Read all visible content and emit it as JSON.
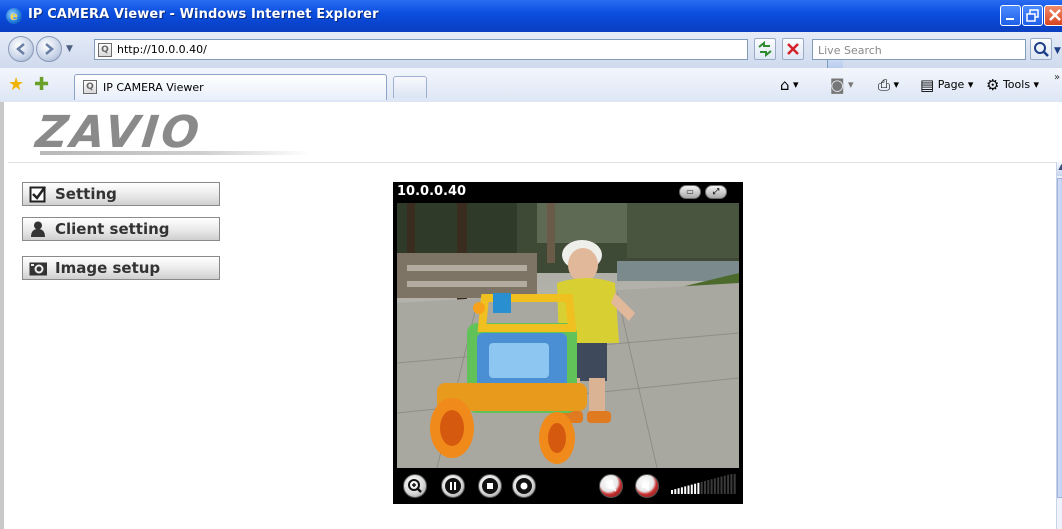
{
  "window": {
    "title": "IP CAMERA Viewer - Windows Internet Explorer",
    "controls": {
      "minimize": "_",
      "maximize": "□",
      "close": "X"
    }
  },
  "addressbar": {
    "url": "http://10.0.0.40/",
    "search_placeholder": "Live Search"
  },
  "tabs": {
    "active_tab_title": "IP CAMERA Viewer"
  },
  "commandbar": {
    "page_label": "Page",
    "tools_label": "Tools"
  },
  "page": {
    "logo_text": "ZAVIO",
    "menu": [
      {
        "label": "Setting",
        "icon": "checkbox-icon"
      },
      {
        "label": "Client setting",
        "icon": "user-icon"
      },
      {
        "label": "Image setup",
        "icon": "camera-icon"
      }
    ]
  },
  "viewer": {
    "camera_ip": "10.0.0.40",
    "volume_level": 0.45
  },
  "colors": {
    "titlebar": "#0b4fe0",
    "page_bg": "#ffffff",
    "viewer_bg": "#000000"
  }
}
